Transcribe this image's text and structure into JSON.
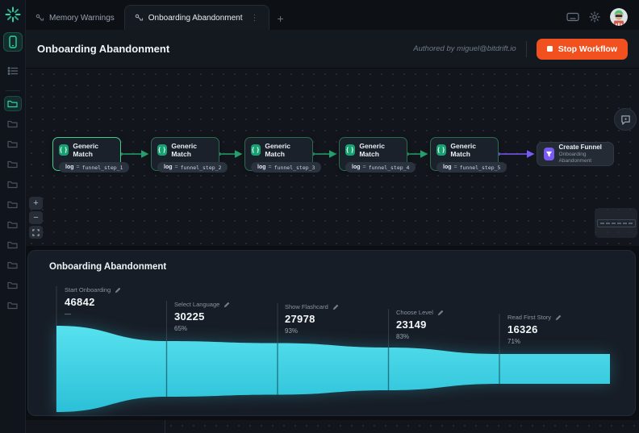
{
  "topbar": {
    "tabs": [
      {
        "label": "Memory Warnings",
        "active": false
      },
      {
        "label": "Onboarding Abandonment",
        "active": true
      }
    ],
    "tab_menu_dots": "⋮",
    "add_tab": "+"
  },
  "header": {
    "title": "Onboarding Abandonment",
    "authored_by": "Authored by miguel@bitdrift.io",
    "stop_button_label": "Stop Workflow"
  },
  "workflow": {
    "nodes": [
      {
        "title": "Generic Match",
        "icon": "braces-icon",
        "field": "log",
        "op": "=",
        "value": "funnel_step_1"
      },
      {
        "title": "Generic Match",
        "icon": "braces-icon",
        "field": "log",
        "op": "=",
        "value": "funnel_step_2"
      },
      {
        "title": "Generic Match",
        "icon": "braces-icon",
        "field": "log",
        "op": "=",
        "value": "funnel_step_3"
      },
      {
        "title": "Generic Match",
        "icon": "braces-icon",
        "field": "log",
        "op": "=",
        "value": "funnel_step_4"
      },
      {
        "title": "Generic Match",
        "icon": "braces-icon",
        "field": "log",
        "op": "=",
        "value": "funnel_step_5"
      }
    ],
    "create_node": {
      "title": "Create Funnel",
      "subtitle": "Onboarding Abandonment",
      "icon": "funnel-icon"
    },
    "zoom_controls": {
      "zoom_in": "+",
      "zoom_out": "−"
    }
  },
  "funnel": {
    "title": "Onboarding Abandonment",
    "steps": [
      {
        "label": "Start Onboarding",
        "value": "46842",
        "sub": "—"
      },
      {
        "label": "Select Language",
        "value": "30225",
        "sub": "65%"
      },
      {
        "label": "Show Flashcard",
        "value": "27978",
        "sub": "93%"
      },
      {
        "label": "Choose Level",
        "value": "23149",
        "sub": "83%"
      },
      {
        "label": "Read First Story",
        "value": "16326",
        "sub": "71%"
      }
    ]
  },
  "chart_data": {
    "type": "area",
    "subtype": "funnel",
    "title": "Onboarding Abandonment",
    "categories": [
      "Start Onboarding",
      "Select Language",
      "Show Flashcard",
      "Choose Level",
      "Read First Story"
    ],
    "values": [
      46842,
      30225,
      27978,
      23149,
      16326
    ],
    "conversion_pct": [
      null,
      65,
      93,
      83,
      71
    ],
    "legend": "none",
    "grid": false
  },
  "sidebar": {
    "icons": [
      "spark-logo",
      "phone-device",
      "list-view"
    ],
    "active_icon": "phone-device",
    "folder_count": 11,
    "active_folder_index": 0
  },
  "colors": {
    "accent_green": "#2fd3a5",
    "node_green": "#17a371",
    "edge_green": "#23a06c",
    "purple": "#7a5af5",
    "funnel_cyan_top": "#57e1ee",
    "funnel_cyan_bottom": "#2bc0d8",
    "stop_orange": "#f1511f"
  }
}
